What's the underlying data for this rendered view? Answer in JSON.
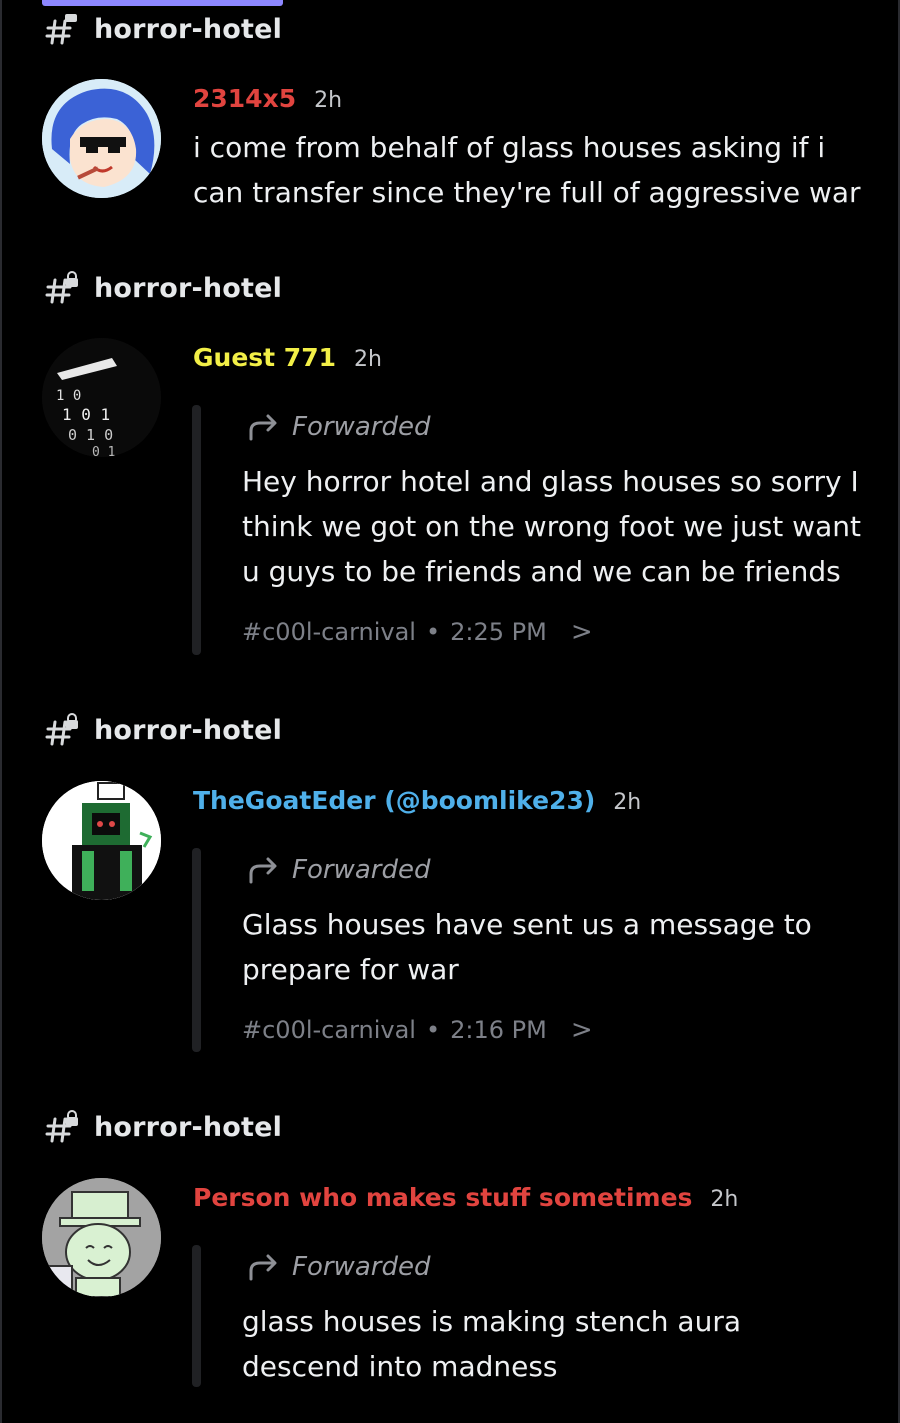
{
  "messages": [
    {
      "channel": "horror-hotel",
      "author": "2314x5",
      "author_color": "#e1443f",
      "time": "2h",
      "text": "i come from behalf of glass houses asking if i can transfer since they're full of aggressive war"
    },
    {
      "channel": "horror-hotel",
      "author": "Guest 771",
      "author_color": "#f2ef47",
      "time": "2h",
      "forwarded_label": "Forwarded",
      "text": "Hey horror hotel and glass houses so sorry I think we got on the wrong foot we just want u guys to be friends and we can be friends",
      "source_channel": "#c00l-carnival",
      "source_sep": "•",
      "source_time": "2:25 PM",
      "source_chevron": ">"
    },
    {
      "channel": "horror-hotel",
      "author": "TheGoatEder (@boomlike23)",
      "author_color": "#4fb0ea",
      "time": "2h",
      "forwarded_label": "Forwarded",
      "text": "Glass houses have sent us a message to prepare for war",
      "source_channel": "#c00l-carnival",
      "source_sep": "•",
      "source_time": "2:16 PM",
      "source_chevron": ">"
    },
    {
      "channel": "horror-hotel",
      "author": "Person who makes stuff sometimes",
      "author_color": "#e1443f",
      "time": "2h",
      "forwarded_label": "Forwarded",
      "text": "glass houses is making stench aura descend into madness"
    }
  ],
  "icons": {
    "channel_icon": "hashtag-with-lock-icon",
    "forward_icon": "forward-arrow-icon"
  }
}
